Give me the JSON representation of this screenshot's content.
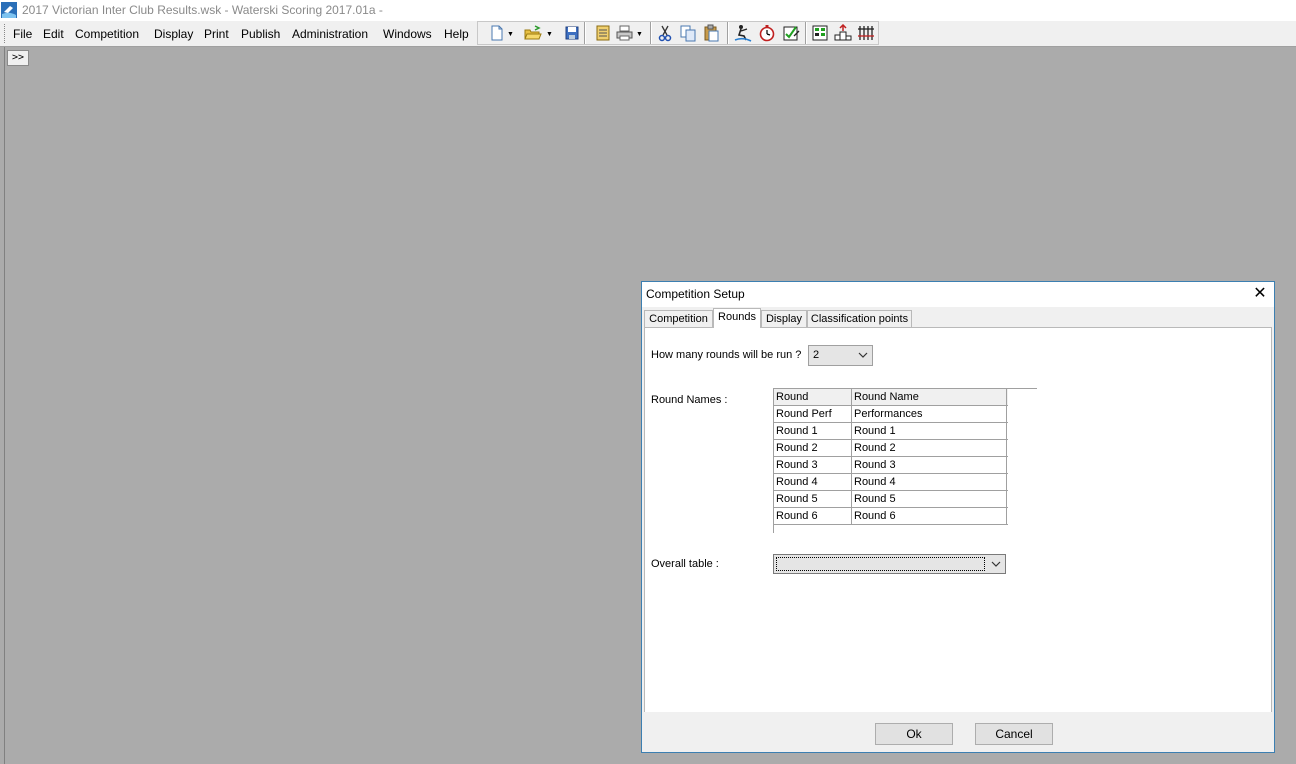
{
  "window": {
    "title": "2017 Victorian Inter Club Results.wsk - Waterski Scoring 2017.01a  -"
  },
  "menu": {
    "items": [
      "File",
      "Edit",
      "Competition",
      "Display",
      "Print",
      "Publish",
      "Administration",
      "Windows",
      "Help"
    ]
  },
  "toolbar": {
    "buttons": [
      "new-document-icon",
      "open-folder-icon",
      "save-icon",
      "properties-icon",
      "print-icon",
      "cut-icon",
      "copy-icon",
      "paste-icon",
      "skier-icon",
      "stopwatch-icon",
      "scoring-icon",
      "scoreboard-icon",
      "podium-icon",
      "results-icon"
    ]
  },
  "mdi": {
    "expand_label": ">>"
  },
  "dialog": {
    "title": "Competition Setup",
    "tabs": [
      "Competition",
      "Rounds",
      "Display",
      "Classification points"
    ],
    "active_tab": "Rounds",
    "rounds_question": "How many rounds will be run ?",
    "rounds_value": "2",
    "round_names_label": "Round Names :",
    "grid": {
      "headers": [
        "Round",
        "Round Name"
      ],
      "rows": [
        [
          "Round Perf",
          "Performances"
        ],
        [
          "Round 1",
          "Round 1"
        ],
        [
          "Round 2",
          "Round 2"
        ],
        [
          "Round 3",
          "Round 3"
        ],
        [
          "Round 4",
          "Round 4"
        ],
        [
          "Round 5",
          "Round 5"
        ],
        [
          "Round 6",
          "Round 6"
        ]
      ]
    },
    "overall_label": "Overall table :",
    "overall_value": "",
    "ok_label": "Ok",
    "cancel_label": "Cancel"
  }
}
